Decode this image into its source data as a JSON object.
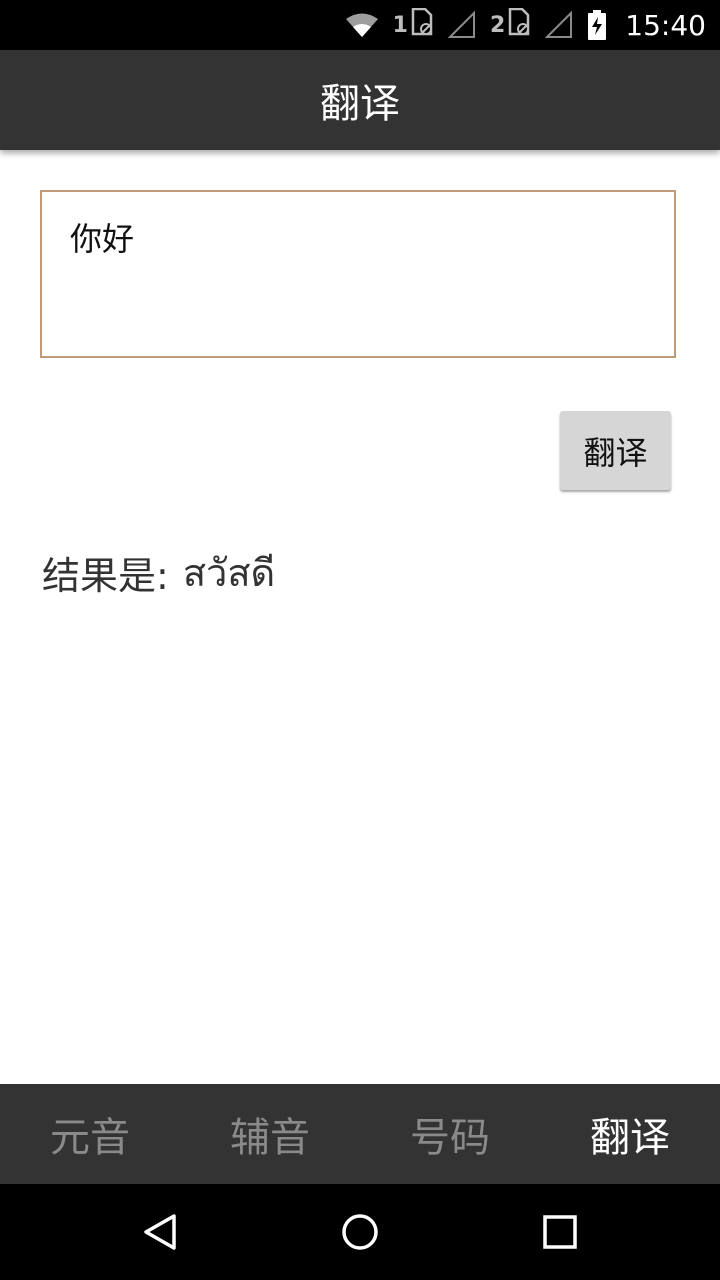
{
  "status_bar": {
    "sim1_label": "1",
    "sim2_label": "2",
    "time": "15:40",
    "icons": [
      "wifi-icon",
      "sim1-icon",
      "signal-icon",
      "sim2-icon",
      "signal-icon",
      "battery-charging-icon"
    ]
  },
  "app_bar": {
    "title": "翻译"
  },
  "input": {
    "value": "你好"
  },
  "translate_button": {
    "label": "翻译"
  },
  "result": {
    "label": "结果是:",
    "value": "สวัสดี"
  },
  "tabs": [
    {
      "label": "元音",
      "active": false
    },
    {
      "label": "辅音",
      "active": false
    },
    {
      "label": "号码",
      "active": false
    },
    {
      "label": "翻译",
      "active": true
    }
  ],
  "nav": {
    "icons": [
      "back-icon",
      "home-icon",
      "recents-icon"
    ]
  },
  "colors": {
    "app_bar": "#333333",
    "input_border": "#c19a7a",
    "button_bg": "#d6d6d6"
  }
}
